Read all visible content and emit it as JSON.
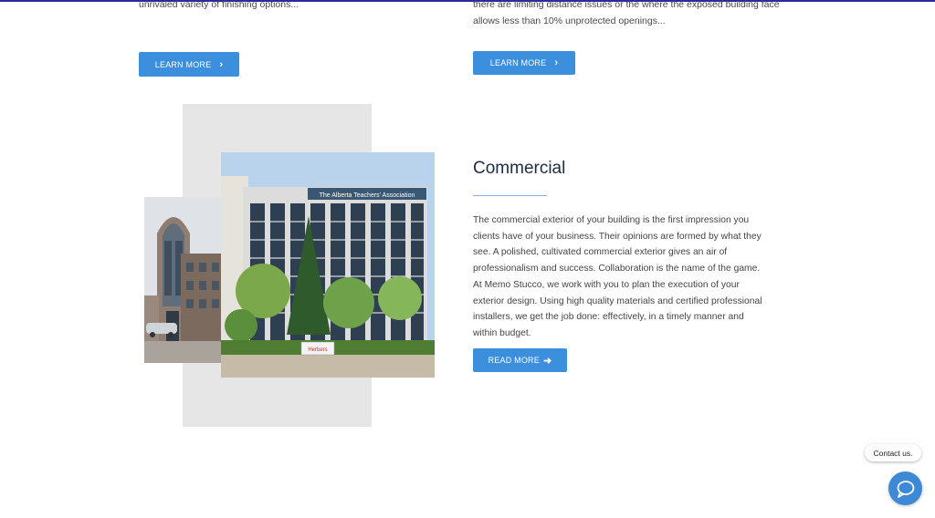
{
  "top_section": {
    "left_snippet": "unrivaled variety of finishing options...",
    "right_snippet": "there are limiting distance issues or the where the exposed building face allows less than 10% unprotected openings...",
    "left_button_label": "LEARN MORE",
    "right_button_label": "LEARN MORE"
  },
  "commercial": {
    "title": "Commercial",
    "body": "The commercial exterior of your building is the first impression you clients have of your business. Their opinions are formed by what they see. A polished, cultivated commercial exterior gives an air of professionalism and success. Collaboration is the name of the game. At Memo Stucco, we work with you to plan the execution of your exterior design. Using high quality materials and certified professional installers, we get the job done: effectively, in a timely manner and within budget.",
    "button_label": "READ MORE",
    "building_sign": "The Alberta Teachers' Association",
    "ground_sign": "Herbers"
  },
  "chat_widget": {
    "bubble_text": "Contact us."
  },
  "colors": {
    "accent": "#3b8fdc",
    "top_bar": "#2f2a9c",
    "title": "#1f2a44",
    "panel": "#e6e6e6"
  },
  "icons": {
    "chevron": "chevron-right-icon",
    "arrow": "arrow-right-icon",
    "chat": "chat-bubble-icon"
  }
}
